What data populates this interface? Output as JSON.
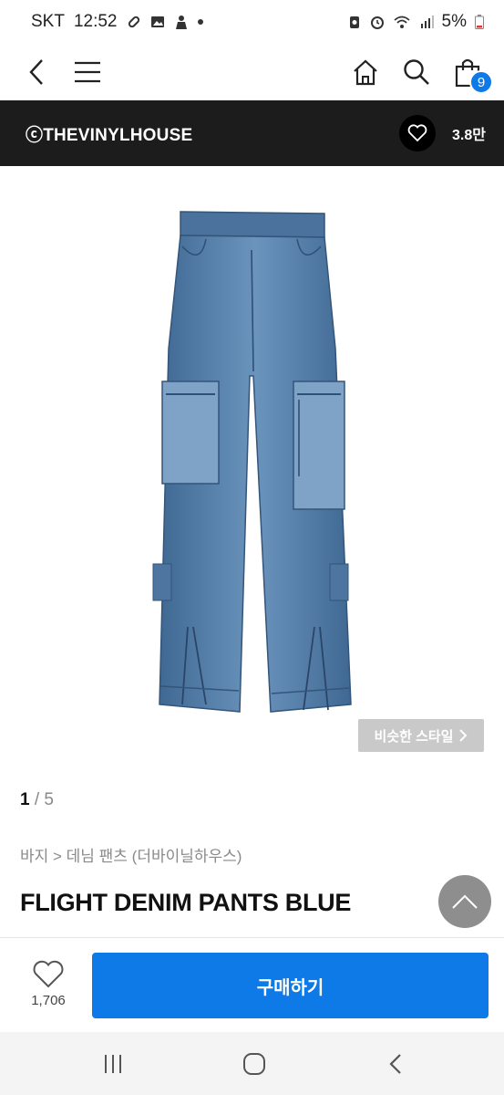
{
  "status_bar": {
    "carrier": "SKT",
    "time": "12:52",
    "battery": "5%",
    "icons": [
      "link-icon",
      "gallery-icon",
      "person-icon",
      "dot-icon",
      "battery-saver-icon",
      "alarm-icon",
      "wifi-icon",
      "signal-icon",
      "battery-icon"
    ]
  },
  "nav": {
    "icons": [
      "back-icon",
      "menu-icon",
      "home-icon",
      "search-icon",
      "cart-icon"
    ],
    "cart_count": "9"
  },
  "brand": {
    "name": "ⓒTHEVINYLHOUSE",
    "likes": "3.8만"
  },
  "gallery": {
    "similar_style_label": "비슷한 스타일",
    "current": "1",
    "separator": "/",
    "total": "5"
  },
  "product": {
    "breadcrumb": "바지 > 데님 팬츠 (더바이닐하우스)",
    "title": "FLIGHT DENIM PANTS BLUE"
  },
  "action_bar": {
    "like_count": "1,706",
    "buy_label": "구매하기"
  },
  "system_nav": {
    "icons": [
      "recent-apps-icon",
      "home-circle-icon",
      "back-chevron-icon"
    ]
  },
  "colors": {
    "brand_bar": "#1c1c1c",
    "accent": "#0e7ae8",
    "denim": "#4f7aa8"
  }
}
